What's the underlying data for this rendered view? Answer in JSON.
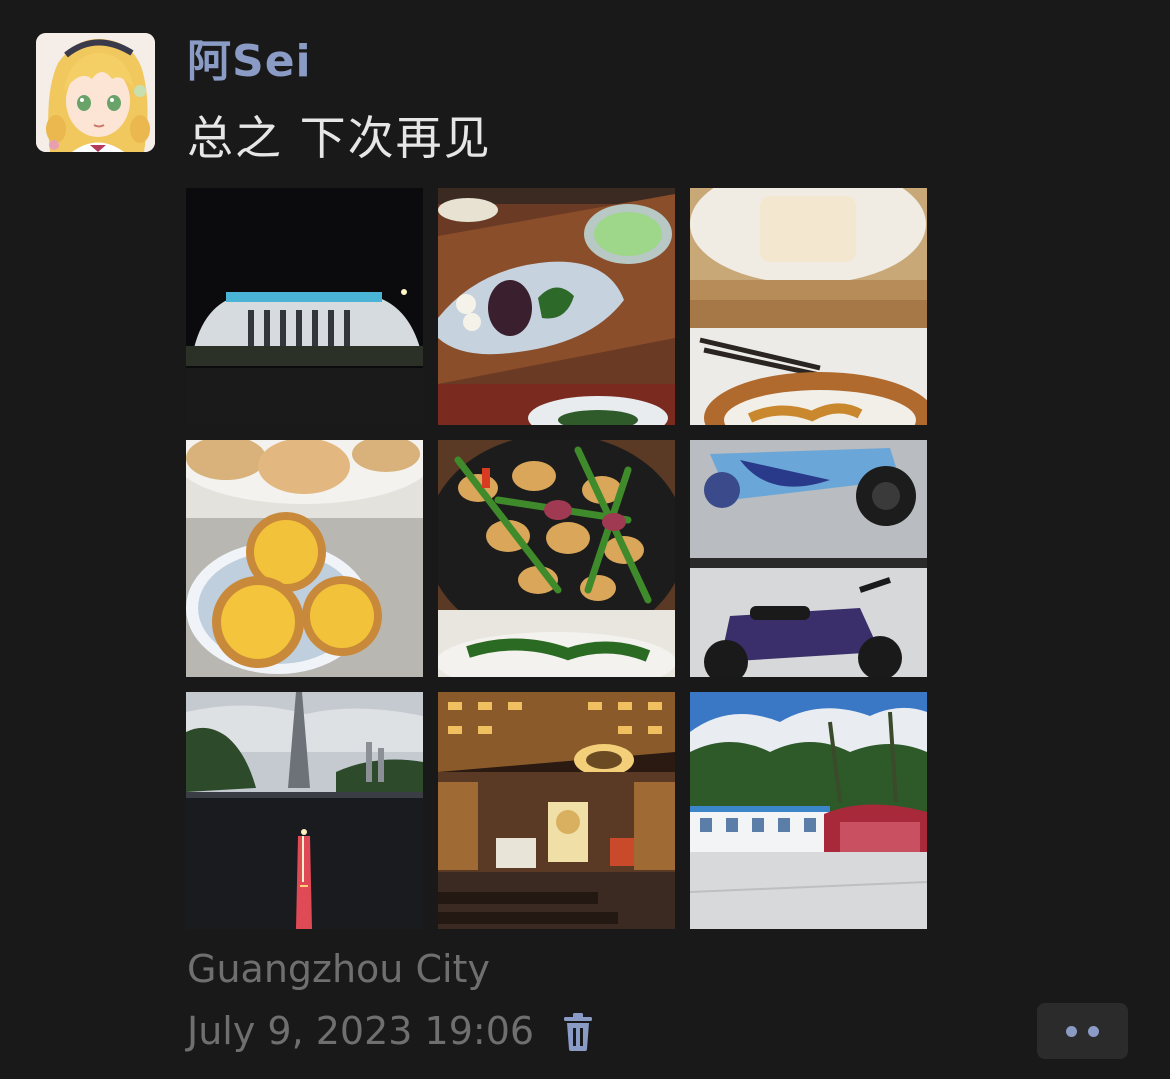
{
  "post": {
    "username": "阿Sei",
    "message": "总之 下次再见",
    "location": "Guangzhou City",
    "timestamp": "July 9, 2023 19:06"
  },
  "photos": [
    {
      "icon": "stadium-night-photo"
    },
    {
      "icon": "dessert-plate-photo"
    },
    {
      "icon": "dim-sum-steamer-photo"
    },
    {
      "icon": "egg-tarts-photo"
    },
    {
      "icon": "stir-fry-dish-photo"
    },
    {
      "icon": "scooters-photo"
    },
    {
      "icon": "canton-tower-photo"
    },
    {
      "icon": "temple-hall-photo"
    },
    {
      "icon": "prefab-buildings-photo"
    }
  ],
  "colors": {
    "background": "#191919",
    "username": "#8a9bc5",
    "message": "#e6e6e6",
    "meta": "#6f6f6f",
    "accent": "#8a9bc5"
  },
  "icons": {
    "delete": "trash-icon",
    "more": "more-dots-icon"
  }
}
